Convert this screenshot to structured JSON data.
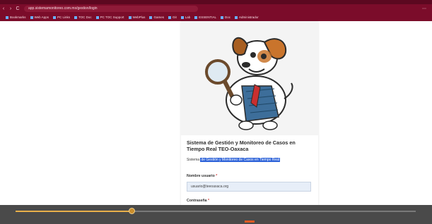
{
  "browser": {
    "url": "app.sistemamonitoreo.com.mx/gestion/login",
    "nav_back": "‹",
    "nav_forward": "›",
    "nav_reload": "C",
    "right_icons": "⋯",
    "bookmarks": [
      {
        "label": "Bookmarks"
      },
      {
        "label": "Web Apps"
      },
      {
        "label": "PC Links"
      },
      {
        "label": "TOC Doc"
      },
      {
        "label": "PC TOC Support"
      },
      {
        "label": "WebPlus"
      },
      {
        "label": "Games"
      },
      {
        "label": "Git"
      },
      {
        "label": "Lab"
      },
      {
        "label": "ESSENTIAL"
      },
      {
        "label": "Doc"
      },
      {
        "label": "Administrador"
      }
    ]
  },
  "login": {
    "title": "Sistema de Gestión y Monitoreo de Casos en Tiempo Real TEO-Oaxaca",
    "subtitle_prefix": "Sistema",
    "subtitle_highlight": "de Gestión y Monitoreo de Casos en Tiempo Real",
    "username_label": "Nombre usuario",
    "username_value": "usuario@teeoaxaca.org",
    "password_label": "Contraseña",
    "password_value": "••••••••••••",
    "required_mark": "*"
  },
  "video": {
    "progress": 0.29
  }
}
